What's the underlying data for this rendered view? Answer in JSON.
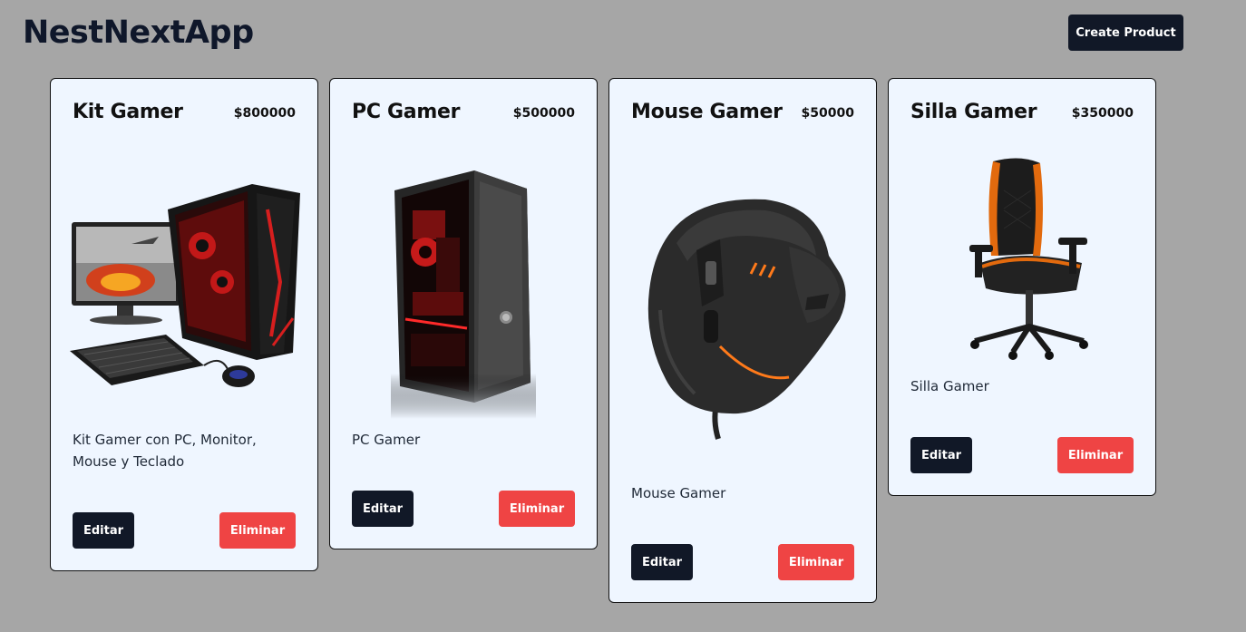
{
  "header": {
    "app_title": "NestNextApp",
    "create_label": "Create Product"
  },
  "products": [
    {
      "name": "Kit Gamer",
      "price": "$800000",
      "description": "Kit Gamer con PC, Monitor, Mouse y Teclado",
      "image": "gaming-pc-kit-image",
      "edit_label": "Editar",
      "delete_label": "Eliminar"
    },
    {
      "name": "PC Gamer",
      "price": "$500000",
      "description": "PC Gamer",
      "image": "gaming-pc-tower-image",
      "edit_label": "Editar",
      "delete_label": "Eliminar"
    },
    {
      "name": "Mouse Gamer",
      "price": "$50000",
      "description": "Mouse Gamer",
      "image": "gaming-mouse-image",
      "edit_label": "Editar",
      "delete_label": "Eliminar"
    },
    {
      "name": "Silla Gamer",
      "price": "$350000",
      "description": "Silla Gamer",
      "image": "gaming-chair-image",
      "edit_label": "Editar",
      "delete_label": "Eliminar"
    }
  ],
  "colors": {
    "background": "#a6a6a6",
    "card_background": "#eff6ff",
    "primary_button": "#111827",
    "danger_button": "#ef4444"
  }
}
